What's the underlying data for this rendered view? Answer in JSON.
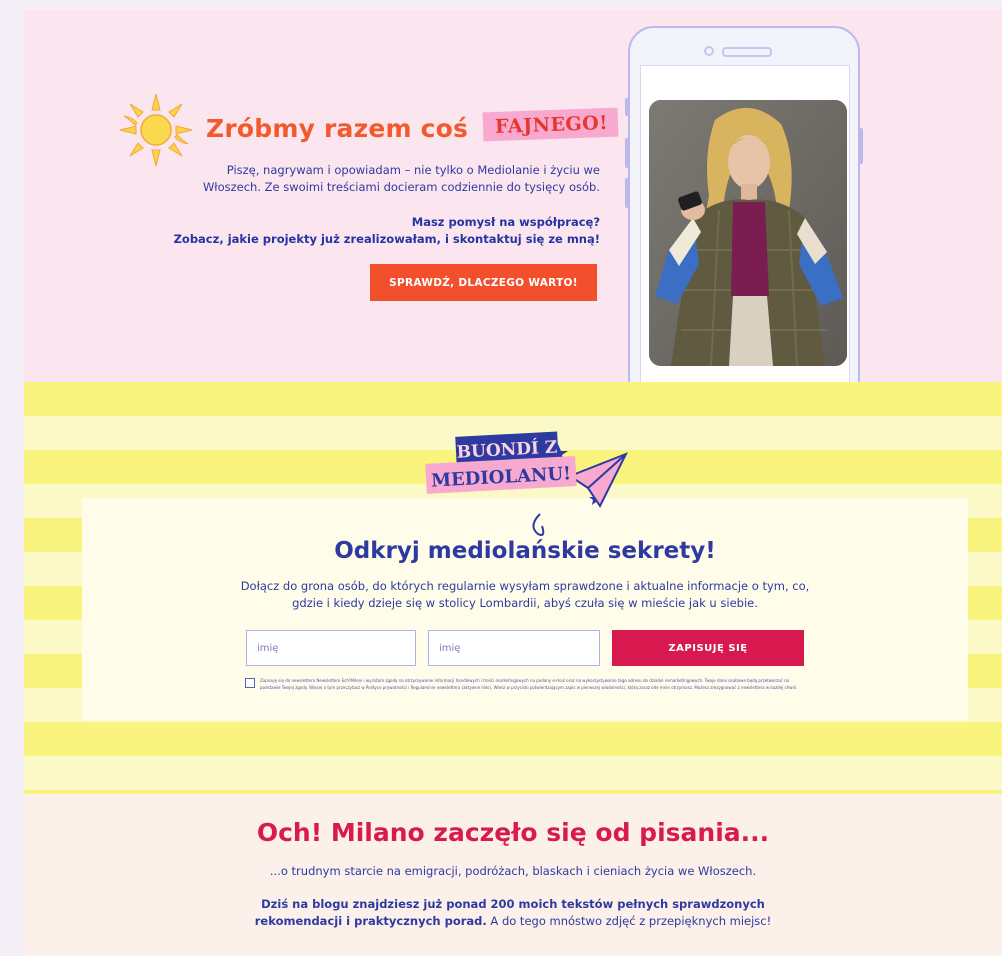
{
  "hero": {
    "title": "Zróbmy razem coś",
    "badge": "FAJNEGO!",
    "intro_line1": "Piszę, nagrywam i opowiadam – nie tylko o Mediolanie i życiu we",
    "intro_line2": "Włoszech. Ze swoimi treściami docieram codziennie do tysięcy osób.",
    "cta_line1": "Masz pomysł na współpracę?",
    "cta_line2": "Zobacz, jakie projekty już zrealizowałam, i skontaktuj się ze mną!",
    "button_label": "SPRAWDŹ, DLACZEGO WARTO!"
  },
  "newsletter": {
    "logo_line1": "BUONDÍ Z",
    "logo_line2": "MEDIOLANU!",
    "title": "Odkryj mediolańskie sekrety!",
    "desc_line1": "Dołącz do grona osób, do których regularnie wysyłam sprawdzone i aktualne informacje o tym, co,",
    "desc_line2": "gdzie i kiedy dzieje się w stolicy Lombardii, abyś czuła się w mieście jak u siebie.",
    "field1_placeholder": "imię",
    "field2_placeholder": "imię",
    "button_label": "ZAPISUJĘ SIĘ",
    "consent_text": "Zapisuję się do newslettera Newslettero Ech!Mileni i wyrażam zgodę na otrzymywanie informacji handlowych i treści marketingowych na podany e-mail oraz na wykorzystywanie tego adresu do działań remarketingowych. Twoje dane osobowe będą przetwarzać na podstawie Twojej zgody. Więcej o tym przeczytasz w Polityce prywatności i Regulaminie newslettera (aktywne linki). Wiesz w przyciski potwierdzającym zapis w pierwszej wiadomości, którą zaraz ode mnie otrzymasz. Możesz zrezygnować z newslettera w każdej chwili."
  },
  "about": {
    "title": "Och! Milano zaczęło się od pisania...",
    "subtitle": "...o trudnym starcie na emigracji, podróżach, blaskach i cieniach życia we Włoszech.",
    "body_bold_1": "Dziś na blogu znajdziesz już ponad 200 moich tekstów pełnych sprawdzonych",
    "body_bold_2": "rekomendacji i praktycznych porad.",
    "body_regular": " A do tego mnóstwo zdjęć z przepięknych miejsc!"
  },
  "colors": {
    "hero_bg": "#fbe5ef",
    "accent_orange": "#f25a2b",
    "badge_pink": "#f7a9cf",
    "text_blue": "#2d3aa0",
    "crimson": "#d8194f",
    "stripe_yellow": "#f8f47e",
    "stripe_light": "#fcf9c8",
    "about_bg": "#fbf0ea"
  },
  "icons": {
    "hero": "sun-icon",
    "phone": "phone-mockup",
    "logo": "paper-plane-icon"
  }
}
